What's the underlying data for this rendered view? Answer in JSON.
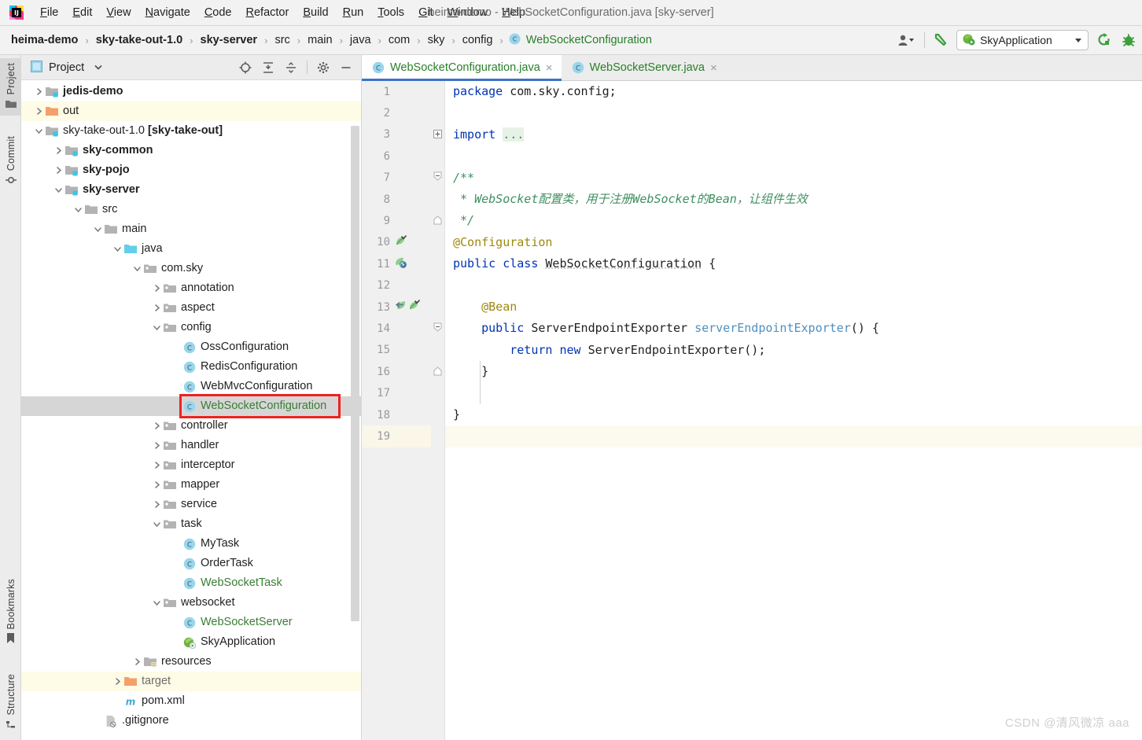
{
  "window": {
    "title": "heima-demo - WebSocketConfiguration.java [sky-server]",
    "logo_icon": "intellij-idea-logo"
  },
  "menubar": {
    "items": [
      {
        "label": "File",
        "mnemonic": "F"
      },
      {
        "label": "Edit",
        "mnemonic": "E"
      },
      {
        "label": "View",
        "mnemonic": "V"
      },
      {
        "label": "Navigate",
        "mnemonic": "N"
      },
      {
        "label": "Code",
        "mnemonic": "C"
      },
      {
        "label": "Refactor",
        "mnemonic": "R"
      },
      {
        "label": "Build",
        "mnemonic": "B"
      },
      {
        "label": "Run",
        "mnemonic": "R"
      },
      {
        "label": "Tools",
        "mnemonic": "T"
      },
      {
        "label": "Git",
        "mnemonic": "G"
      },
      {
        "label": "Window",
        "mnemonic": "W"
      },
      {
        "label": "Help",
        "mnemonic": "H"
      }
    ]
  },
  "navbar": {
    "crumbs": [
      {
        "label": "heima-demo",
        "bold": true
      },
      {
        "label": "sky-take-out-1.0",
        "bold": true
      },
      {
        "label": "sky-server",
        "bold": true
      },
      {
        "label": "src",
        "bold": false
      },
      {
        "label": "main",
        "bold": false
      },
      {
        "label": "java",
        "bold": false
      },
      {
        "label": "com",
        "bold": false
      },
      {
        "label": "sky",
        "bold": false
      },
      {
        "label": "config",
        "bold": false
      },
      {
        "label": "WebSocketConfiguration",
        "bold": false,
        "green": true,
        "icon": "java-class-icon"
      }
    ],
    "separator": "›",
    "right": {
      "user_icon": "user-account-icon",
      "hammer_icon": "build-hammer-icon",
      "run_config_label": "SkyApplication",
      "run_config_icon": "spring-boot-run-icon",
      "rerun_icon": "rerun-icon",
      "debug_icon": "debug-bug-icon"
    }
  },
  "toolstrip": {
    "top": [
      {
        "label": "Project",
        "icon": "project-folder-icon",
        "selected": true
      },
      {
        "label": "Commit",
        "icon": "commit-icon",
        "selected": false
      }
    ],
    "bottom": [
      {
        "label": "Bookmarks",
        "icon": "bookmark-icon",
        "selected": false
      },
      {
        "label": "Structure",
        "icon": "structure-icon",
        "selected": false
      }
    ]
  },
  "project_pane": {
    "title": "Project",
    "title_icon": "project-view-icon",
    "dropdown_icon": "chevron-down-icon",
    "toolbar": [
      {
        "name": "select-opened-file-icon",
        "glyph": "crosshair"
      },
      {
        "name": "expand-all-icon",
        "glyph": "expand"
      },
      {
        "name": "collapse-all-icon",
        "glyph": "collapse"
      },
      {
        "name": "settings-gear-icon",
        "glyph": "gear"
      },
      {
        "name": "hide-panel-icon",
        "glyph": "minus"
      }
    ],
    "tree": [
      {
        "label": "jedis-demo",
        "indent": 1,
        "arrow": "collapsed",
        "icon": "module-folder-icon",
        "bold": true
      },
      {
        "label": "out",
        "indent": 1,
        "arrow": "collapsed",
        "icon": "excluded-folder-icon",
        "bold": false,
        "highlight": "yellow"
      },
      {
        "label": "sky-take-out-1.0 [sky-take-out]",
        "indent": 1,
        "arrow": "expanded",
        "icon": "module-folder-icon",
        "bold": false,
        "bold_suffix": "[sky-take-out]"
      },
      {
        "label": "sky-common",
        "indent": 2,
        "arrow": "collapsed",
        "icon": "module-folder-icon",
        "bold": true
      },
      {
        "label": "sky-pojo",
        "indent": 2,
        "arrow": "collapsed",
        "icon": "module-folder-icon",
        "bold": true
      },
      {
        "label": "sky-server",
        "indent": 2,
        "arrow": "expanded",
        "icon": "module-folder-icon",
        "bold": true
      },
      {
        "label": "src",
        "indent": 3,
        "arrow": "expanded",
        "icon": "folder-icon",
        "bold": false
      },
      {
        "label": "main",
        "indent": 4,
        "arrow": "expanded",
        "icon": "folder-icon",
        "bold": false
      },
      {
        "label": "java",
        "indent": 5,
        "arrow": "expanded",
        "icon": "source-root-folder-icon",
        "bold": false
      },
      {
        "label": "com.sky",
        "indent": 6,
        "arrow": "expanded",
        "icon": "package-icon",
        "bold": false
      },
      {
        "label": "annotation",
        "indent": 7,
        "arrow": "collapsed",
        "icon": "package-icon",
        "bold": false
      },
      {
        "label": "aspect",
        "indent": 7,
        "arrow": "collapsed",
        "icon": "package-icon",
        "bold": false
      },
      {
        "label": "config",
        "indent": 7,
        "arrow": "expanded",
        "icon": "package-icon",
        "bold": false
      },
      {
        "label": "OssConfiguration",
        "indent": 8,
        "arrow": "none",
        "icon": "java-class-icon",
        "bold": false
      },
      {
        "label": "RedisConfiguration",
        "indent": 8,
        "arrow": "none",
        "icon": "java-class-icon",
        "bold": false
      },
      {
        "label": "WebMvcConfiguration",
        "indent": 8,
        "arrow": "none",
        "icon": "java-class-icon",
        "bold": false
      },
      {
        "label": "WebSocketConfiguration",
        "indent": 8,
        "arrow": "none",
        "icon": "java-class-icon",
        "bold": false,
        "green": true,
        "selected": true,
        "annotated": true
      },
      {
        "label": "controller",
        "indent": 7,
        "arrow": "collapsed",
        "icon": "package-icon",
        "bold": false
      },
      {
        "label": "handler",
        "indent": 7,
        "arrow": "collapsed",
        "icon": "package-icon",
        "bold": false
      },
      {
        "label": "interceptor",
        "indent": 7,
        "arrow": "collapsed",
        "icon": "package-icon",
        "bold": false
      },
      {
        "label": "mapper",
        "indent": 7,
        "arrow": "collapsed",
        "icon": "package-icon",
        "bold": false
      },
      {
        "label": "service",
        "indent": 7,
        "arrow": "collapsed",
        "icon": "package-icon",
        "bold": false
      },
      {
        "label": "task",
        "indent": 7,
        "arrow": "expanded",
        "icon": "package-icon",
        "bold": false
      },
      {
        "label": "MyTask",
        "indent": 8,
        "arrow": "none",
        "icon": "java-class-icon",
        "bold": false
      },
      {
        "label": "OrderTask",
        "indent": 8,
        "arrow": "none",
        "icon": "java-class-icon",
        "bold": false
      },
      {
        "label": "WebSocketTask",
        "indent": 8,
        "arrow": "none",
        "icon": "java-class-icon",
        "bold": false,
        "green": true
      },
      {
        "label": "websocket",
        "indent": 7,
        "arrow": "expanded",
        "icon": "package-icon",
        "bold": false
      },
      {
        "label": "WebSocketServer",
        "indent": 8,
        "arrow": "none",
        "icon": "java-class-icon",
        "bold": false,
        "green": true
      },
      {
        "label": "SkyApplication",
        "indent": 8,
        "arrow": "none",
        "icon": "spring-boot-class-icon",
        "bold": false
      },
      {
        "label": "resources",
        "indent": 6,
        "arrow": "collapsed",
        "icon": "resources-folder-icon",
        "bold": false
      },
      {
        "label": "target",
        "indent": 5,
        "arrow": "collapsed",
        "icon": "excluded-folder-icon",
        "bold": false,
        "grey": true,
        "highlight": "yellow"
      },
      {
        "label": "pom.xml",
        "indent": 5,
        "arrow": "none",
        "icon": "maven-pom-icon",
        "bold": false
      },
      {
        "label": ".gitignore",
        "indent": 4,
        "arrow": "none",
        "icon": "gitignore-icon",
        "bold": false
      }
    ]
  },
  "editor": {
    "tabs": [
      {
        "label": "WebSocketConfiguration.java",
        "icon": "java-class-icon",
        "active": true,
        "close_icon": "close-icon"
      },
      {
        "label": "WebSocketServer.java",
        "icon": "java-class-icon",
        "active": false,
        "close_icon": "close-icon"
      }
    ],
    "caret_line": 19,
    "lines": [
      {
        "n": 1,
        "gutter_icons": [],
        "fold": "",
        "html": "<span class='k'>package</span> <span class='nm'>com.sky.config;</span>"
      },
      {
        "n": 2,
        "gutter_icons": [],
        "fold": "",
        "html": ""
      },
      {
        "n": 3,
        "gutter_icons": [],
        "fold": "plus",
        "html": "<span class='k'>import</span> <span class='fold-ph'>...</span>"
      },
      {
        "n": 6,
        "gutter_icons": [],
        "fold": "",
        "html": ""
      },
      {
        "n": 7,
        "gutter_icons": [],
        "fold": "start",
        "html": "<span class='cm'>/**</span>"
      },
      {
        "n": 8,
        "gutter_icons": [],
        "fold": "",
        "html": "<span class='cm'> * WebSocket配置类，用于注册WebSocket的Bean，让组件生效</span>"
      },
      {
        "n": 9,
        "gutter_icons": [],
        "fold": "end",
        "html": "<span class='cm'> */</span>"
      },
      {
        "n": 10,
        "gutter_icons": [
          "spring-bean-icon"
        ],
        "fold": "",
        "html": "<span class='an'>@Configuration</span>"
      },
      {
        "n": 11,
        "gutter_icons": [
          "spring-config-icon"
        ],
        "fold": "",
        "html": "<span class='k'>public</span> <span class='k'>class</span> <span class='nm underline-wavy'>WebSocketConfiguration</span> <span class='nm'>{</span>"
      },
      {
        "n": 12,
        "gutter_icons": [],
        "fold": "",
        "html": ""
      },
      {
        "n": 13,
        "gutter_icons": [
          "spring-navigate-icon",
          "spring-bean-icon"
        ],
        "fold": "",
        "html": "    <span class='an'>@Bean</span>"
      },
      {
        "n": 14,
        "gutter_icons": [],
        "fold": "start",
        "html": "    <span class='k'>public</span> <span class='nm'>ServerEndpointExporter</span> <span class='fn'>serverEndpointExporter</span><span class='nm'>() {</span>"
      },
      {
        "n": 15,
        "gutter_icons": [],
        "fold": "",
        "html": "        <span class='k'>return</span> <span class='k'>new</span> <span class='nm'>ServerEndpointExporter</span><span class='nm'>();</span>"
      },
      {
        "n": 16,
        "gutter_icons": [],
        "fold": "end",
        "html": "    <span class='nm'>}</span>"
      },
      {
        "n": 17,
        "gutter_icons": [],
        "fold": "",
        "html": ""
      },
      {
        "n": 18,
        "gutter_icons": [],
        "fold": "",
        "html": "<span class='nm'>}</span>"
      },
      {
        "n": 19,
        "gutter_icons": [],
        "fold": "",
        "html": ""
      }
    ]
  },
  "watermark": "CSDN @清风微凉 aaa",
  "colors": {
    "accent_blue": "#3d71c7",
    "green_text": "#2a7f2a",
    "annotation_red": "#ef2121",
    "keyword_blue": "#0033b3",
    "comment_green": "#3f8f5f",
    "caret_line": "#fcf9ee",
    "selection_grey": "#d6d6d6"
  }
}
